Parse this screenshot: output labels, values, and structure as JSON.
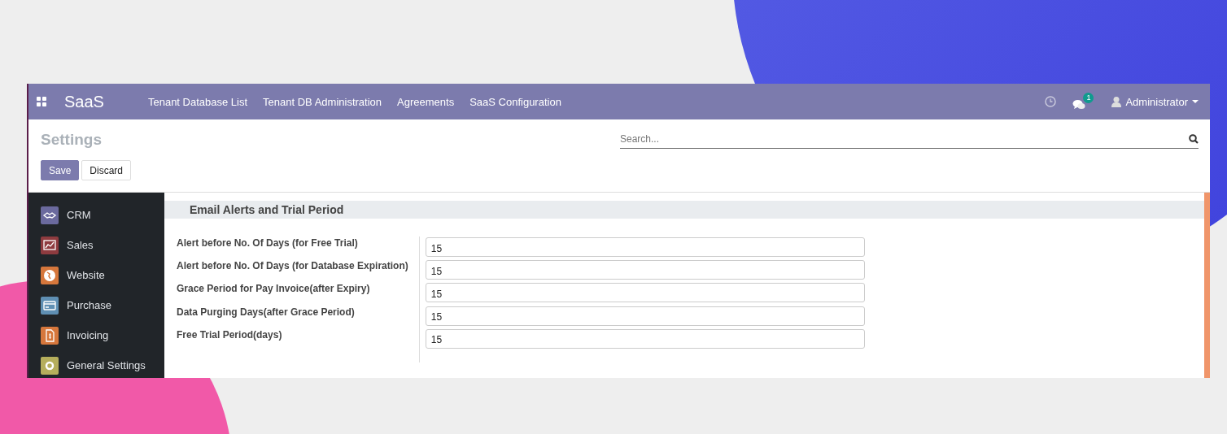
{
  "navbar": {
    "app_name": "SaaS",
    "menu": [
      "Tenant Database List",
      "Tenant DB Administration",
      "Agreements",
      "SaaS Configuration"
    ],
    "messages_badge": "1",
    "user": "Administrator"
  },
  "control_panel": {
    "title": "Settings",
    "search": {
      "placeholder": "Search..."
    },
    "buttons": [
      {
        "label": "Save",
        "kind": "primary"
      },
      {
        "label": "Discard",
        "kind": "secondary"
      }
    ]
  },
  "sidebar": {
    "items": [
      {
        "label": "CRM",
        "color": "#6b6a9e"
      },
      {
        "label": "Sales",
        "color": "#8e3b3f"
      },
      {
        "label": "Website",
        "color": "#d6773c"
      },
      {
        "label": "Purchase",
        "color": "#5f8fb3"
      },
      {
        "label": "Invoicing",
        "color": "#d6773c"
      },
      {
        "label": "General Settings",
        "color": "#b5ae5c"
      }
    ]
  },
  "section": {
    "title": "Email Alerts and Trial Period",
    "fields": [
      {
        "label": "Alert before No. Of Days (for Free Trial)",
        "value": "15"
      },
      {
        "label": "Alert before No. Of Days (for Database Expiration)",
        "value": "15"
      },
      {
        "label": "Grace Period for Pay Invoice(after Expiry)",
        "value": "15"
      },
      {
        "label": "Data Purging Days(after Grace Period)",
        "value": "15"
      },
      {
        "label": "Free Trial Period(days)",
        "value": "15"
      }
    ]
  }
}
